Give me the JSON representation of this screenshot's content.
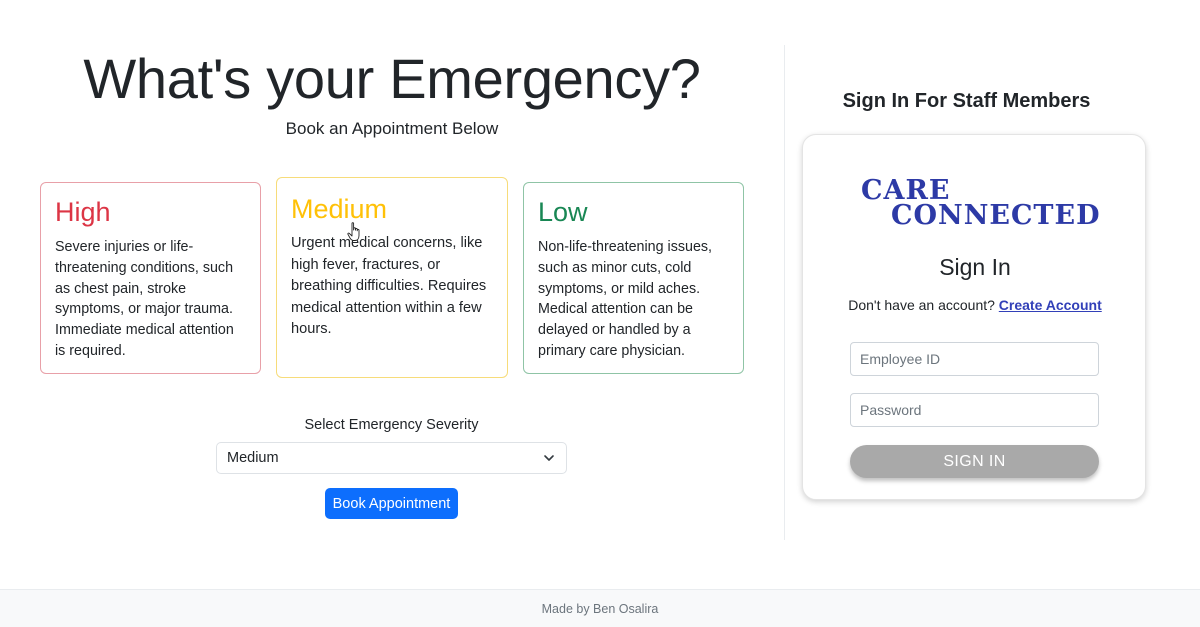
{
  "hero": {
    "title": "What's your Emergency?",
    "subtitle": "Book an Appointment Below"
  },
  "cards": [
    {
      "title": "High",
      "text": "Severe injuries or life-threatening conditions, such as chest pain, stroke symptoms, or major trauma. Immediate medical attention is required.",
      "color": "#dc3545"
    },
    {
      "title": "Medium",
      "text": "Urgent medical concerns, like high fever, fractures, or breathing difficulties. Requires medical attention within a few hours.",
      "color": "#ffc107"
    },
    {
      "title": "Low",
      "text": "Non-life-threatening issues, such as minor cuts, cold symptoms, or mild aches. Medical attention can be delayed or handled by a primary care physician.",
      "color": "#198754"
    }
  ],
  "booking": {
    "select_label": "Select Emergency Severity",
    "selected_value": "Medium",
    "button_label": "Book Appointment",
    "button_color": "#0d6efd"
  },
  "staff": {
    "heading": "Sign In For Staff Members",
    "logo_line1": "CARE",
    "logo_line2": "CONNECTED",
    "logo_color": "#2d3aa6",
    "signin_title": "Sign In",
    "account_prompt": "Don't have an account?",
    "create_link": "Create Account",
    "employee_placeholder": "Employee ID",
    "employee_value": "",
    "password_placeholder": "Password",
    "password_value": "",
    "signin_button": "SIGN IN"
  },
  "icons": {
    "select_chevron": "chevron-down-icon",
    "cursor": "hand-pointer-icon"
  },
  "footer": {
    "text": "Made by Ben Osalira"
  }
}
